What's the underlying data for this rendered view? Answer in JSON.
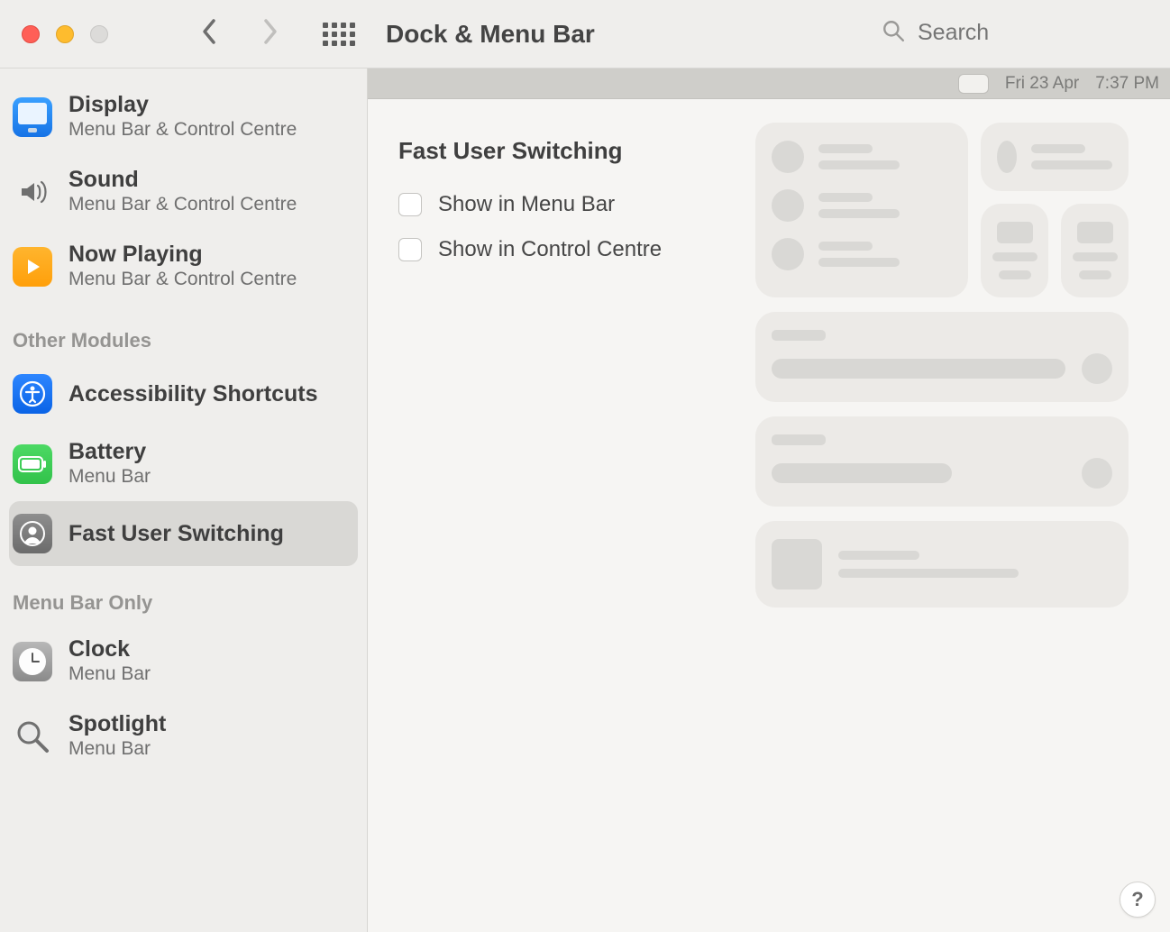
{
  "window": {
    "title": "Dock & Menu Bar"
  },
  "search": {
    "placeholder": "Search",
    "value": ""
  },
  "menubar_preview": {
    "date": "Fri 23 Apr",
    "time": "7:37 PM"
  },
  "sidebar": {
    "items": [
      {
        "title": "Display",
        "sub": "Menu Bar & Control Centre"
      },
      {
        "title": "Sound",
        "sub": "Menu Bar & Control Centre"
      },
      {
        "title": "Now Playing",
        "sub": "Menu Bar & Control Centre"
      }
    ],
    "heading_other": "Other Modules",
    "other": [
      {
        "title": "Accessibility Shortcuts",
        "sub": ""
      },
      {
        "title": "Battery",
        "sub": "Menu Bar"
      },
      {
        "title": "Fast User Switching",
        "sub": ""
      }
    ],
    "heading_mbonly": "Menu Bar Only",
    "mbonly": [
      {
        "title": "Clock",
        "sub": "Menu Bar"
      },
      {
        "title": "Spotlight",
        "sub": "Menu Bar"
      }
    ]
  },
  "content": {
    "heading": "Fast User Switching",
    "checkboxes": [
      {
        "label": "Show in Menu Bar",
        "checked": false
      },
      {
        "label": "Show in Control Centre",
        "checked": false
      }
    ]
  },
  "help": {
    "label": "?"
  }
}
